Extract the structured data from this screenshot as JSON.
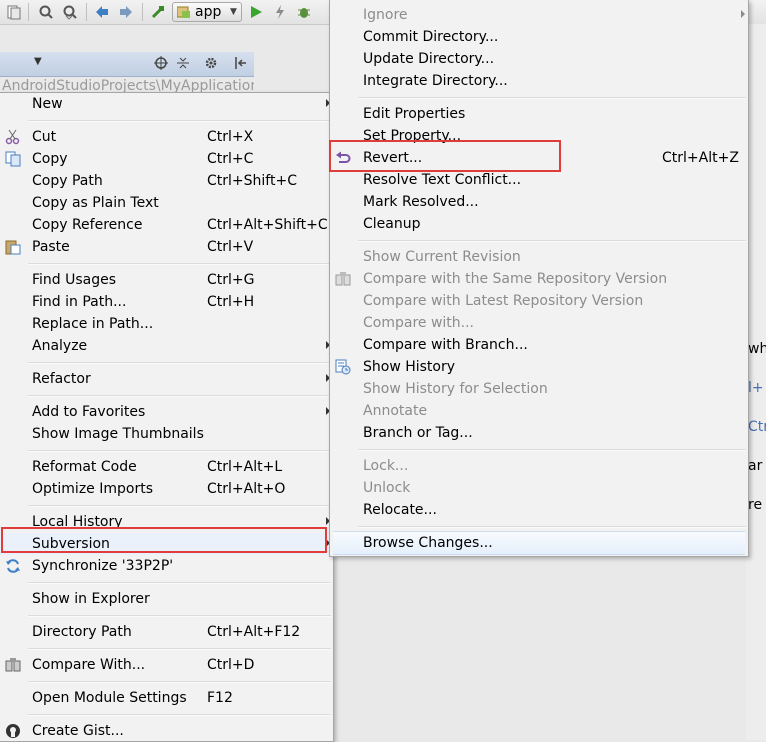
{
  "toolbar": {
    "run_config_label": "app",
    "icons": [
      "sync-icon",
      "find-icon",
      "replace-icon",
      "back-icon",
      "forward-icon",
      "build-icon",
      "android-module-icon",
      "run-icon",
      "bolt-icon",
      "debug-icon"
    ]
  },
  "project_panel": {
    "path": "AndroidStudioProjects\\MyApplication"
  },
  "right_fragments": [
    "wh",
    "l+",
    "Ctr",
    "ar",
    "re"
  ],
  "left_menu": {
    "new": "New",
    "cut": "Cut",
    "cut_sc": "Ctrl+X",
    "copy": "Copy",
    "copy_sc": "Ctrl+C",
    "copy_path": "Copy Path",
    "copy_path_sc": "Ctrl+Shift+C",
    "copy_plain": "Copy as Plain Text",
    "copy_ref": "Copy Reference",
    "copy_ref_sc": "Ctrl+Alt+Shift+C",
    "paste": "Paste",
    "paste_sc": "Ctrl+V",
    "find_usages": "Find Usages",
    "find_usages_sc": "Ctrl+G",
    "find_in_path": "Find in Path...",
    "find_in_path_sc": "Ctrl+H",
    "replace_in_path": "Replace in Path...",
    "analyze": "Analyze",
    "refactor": "Refactor",
    "add_favorites": "Add to Favorites",
    "show_thumbnails": "Show Image Thumbnails",
    "reformat": "Reformat Code",
    "reformat_sc": "Ctrl+Alt+L",
    "optimize": "Optimize Imports",
    "optimize_sc": "Ctrl+Alt+O",
    "local_history": "Local History",
    "subversion": "Subversion",
    "synchronize": "Synchronize '33P2P'",
    "show_explorer": "Show in Explorer",
    "directory_path": "Directory Path",
    "directory_path_sc": "Ctrl+Alt+F12",
    "compare_with": "Compare With...",
    "compare_with_sc": "Ctrl+D",
    "module_settings": "Open Module Settings",
    "module_settings_sc": "F12",
    "create_gist": "Create Gist..."
  },
  "right_menu": {
    "ignore": "Ignore",
    "commit_dir": "Commit Directory...",
    "update_dir": "Update Directory...",
    "integrate_dir": "Integrate Directory...",
    "edit_props": "Edit Properties",
    "set_prop": "Set Property...",
    "revert": "Revert...",
    "revert_sc": "Ctrl+Alt+Z",
    "resolve_conflict": "Resolve Text Conflict...",
    "mark_resolved": "Mark Resolved...",
    "cleanup": "Cleanup",
    "show_current_rev": "Show Current Revision",
    "compare_same_repo": "Compare with the Same Repository Version",
    "compare_latest_repo": "Compare with Latest Repository Version",
    "compare_with": "Compare with...",
    "compare_branch": "Compare with Branch...",
    "show_history": "Show History",
    "show_history_sel": "Show History for Selection",
    "annotate": "Annotate",
    "branch_tag": "Branch or Tag...",
    "lock": "Lock...",
    "unlock": "Unlock",
    "relocate": "Relocate...",
    "browse_changes": "Browse Changes..."
  },
  "colors": {
    "highlight_box": "#e03c3c",
    "menu_bg": "#f2f2f2",
    "disabled_text": "#8c8c8c"
  }
}
